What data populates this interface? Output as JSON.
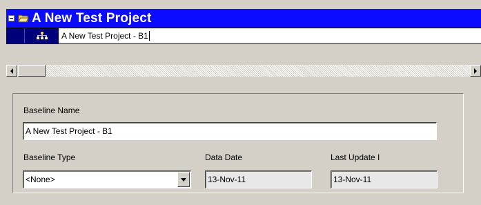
{
  "project": {
    "title": "A New Test Project"
  },
  "baseline_row": {
    "value": "A New Test Project - B1"
  },
  "form": {
    "baseline_name_label": "Baseline Name",
    "baseline_name_value": "A New Test Project - B1",
    "baseline_type_label": "Baseline Type",
    "baseline_type_value": "<None>",
    "data_date_label": "Data Date",
    "data_date_value": "13-Nov-11",
    "last_update_label": "Last Update I",
    "last_update_value": "13-Nov-11"
  },
  "icons": {
    "expand": "collapse-minus-icon",
    "project": "folder-open-icon",
    "baseline": "baseline-hierarchy-icon",
    "scroll_left": "arrow-left-icon",
    "scroll_right": "arrow-right-icon",
    "dropdown": "chevron-down-icon"
  },
  "colors": {
    "title_bar": "#0b0bff",
    "title_text": "#ffffff",
    "selected_cell": "#00007a",
    "window_face": "#d4d0c8"
  }
}
